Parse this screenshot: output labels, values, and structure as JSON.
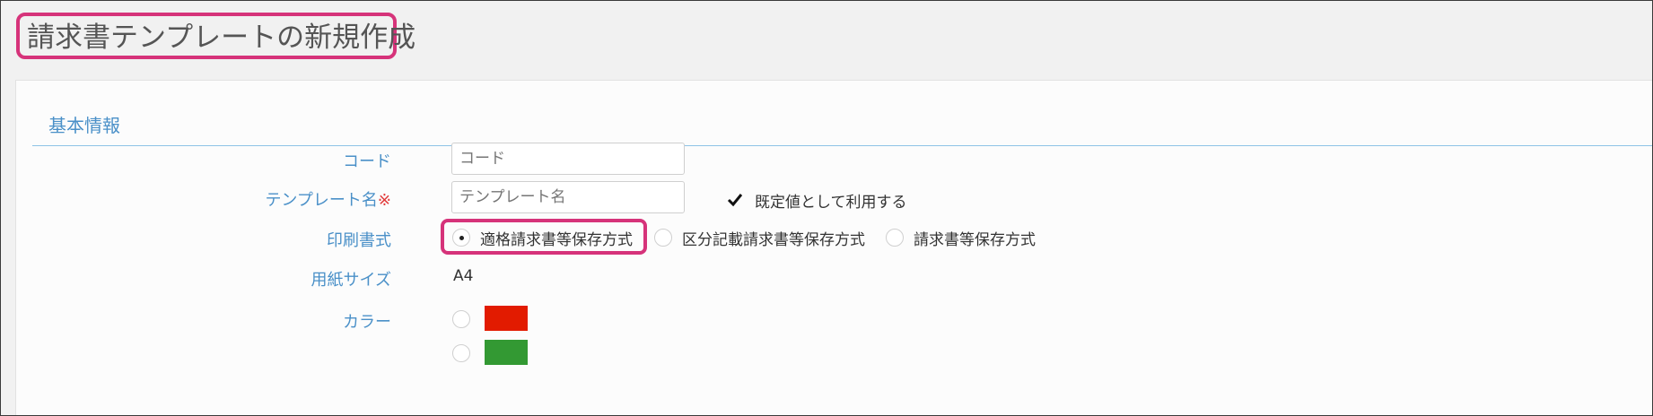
{
  "page": {
    "title": "請求書テンプレートの新規作成"
  },
  "section": {
    "title": "基本情報"
  },
  "form": {
    "code": {
      "label": "コード",
      "placeholder": "コード",
      "value": ""
    },
    "template_name": {
      "label": "テンプレート名",
      "required_mark": "※",
      "placeholder": "テンプレート名",
      "value": "",
      "default_checkbox": {
        "label": "既定値として利用する",
        "checked": true
      }
    },
    "print_format": {
      "label": "印刷書式",
      "options": [
        {
          "label": "適格請求書等保存方式",
          "selected": true
        },
        {
          "label": "区分記載請求書等保存方式",
          "selected": false
        },
        {
          "label": "請求書等保存方式",
          "selected": false
        }
      ]
    },
    "paper_size": {
      "label": "用紙サイズ",
      "value": "A4"
    },
    "color": {
      "label": "カラー",
      "options": [
        {
          "color": "#e21b00",
          "selected": false
        },
        {
          "color": "#339933",
          "selected": false
        }
      ]
    }
  },
  "colors": {
    "accent_label": "#4a90c8",
    "highlight": "#d6337a"
  }
}
